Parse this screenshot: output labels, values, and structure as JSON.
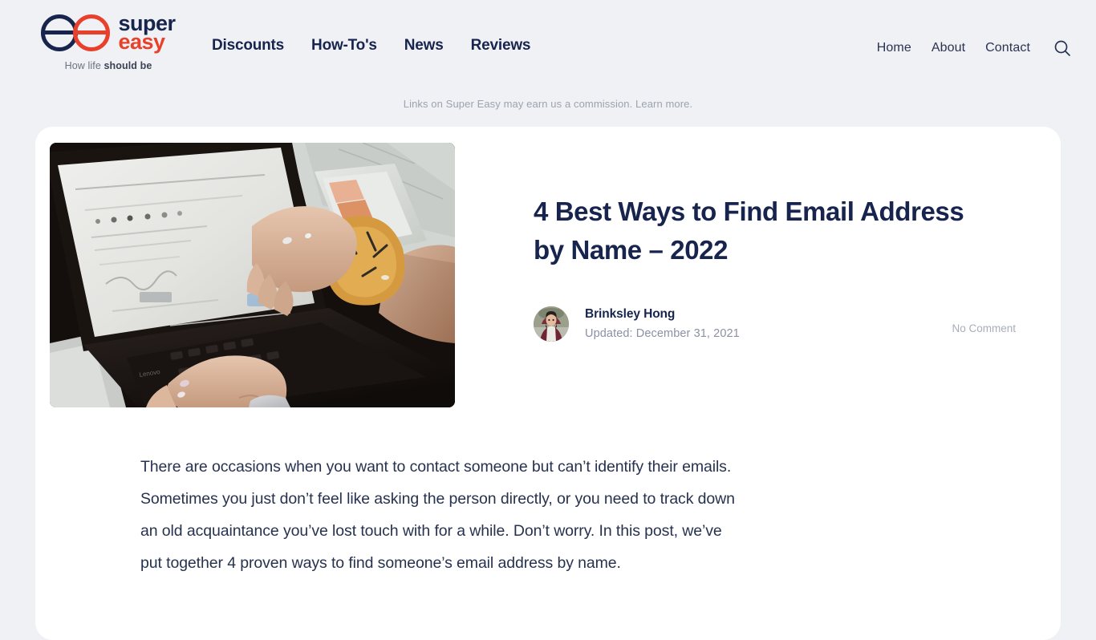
{
  "header": {
    "brand": {
      "logo_icon": "superEasy-double-e-logo",
      "word_super": "super",
      "word_easy": "easy",
      "tagline_regular": "How life ",
      "tagline_bold": "should be"
    },
    "nav_main": [
      {
        "label": "Discounts"
      },
      {
        "label": "How-To's"
      },
      {
        "label": "News"
      },
      {
        "label": "Reviews"
      }
    ],
    "nav_right": [
      {
        "label": "Home"
      },
      {
        "label": "About"
      },
      {
        "label": "Contact"
      }
    ],
    "search_icon": "search-icon"
  },
  "disclaimer": {
    "text": "Links on Super Easy may earn us a commission. ",
    "link_label": "Learn more."
  },
  "post": {
    "hero_image_alt": "hands typing on a dark Lenovo laptop beside an orange makeup palette",
    "title": "4 Best Ways to Find Email Address by Name – 2022",
    "author": "Brinksley Hong",
    "updated": "Updated: December 31, 2021",
    "comments": "No Comment",
    "body_paragraph": "There are occasions when you want to contact someone but can’t identify their emails. Sometimes you just don’t feel like asking the person directly, or you need to track down an old acquaintance you’ve lost touch with for a while. Don’t worry. In this post, we’ve put together 4 proven ways to find someone’s email address by name."
  },
  "colors": {
    "page_background": "#f0f1f5",
    "card_background": "#ffffff",
    "brand_navy": "#17244d",
    "brand_red": "#e8402a",
    "muted_text": "#9ca3b0"
  }
}
